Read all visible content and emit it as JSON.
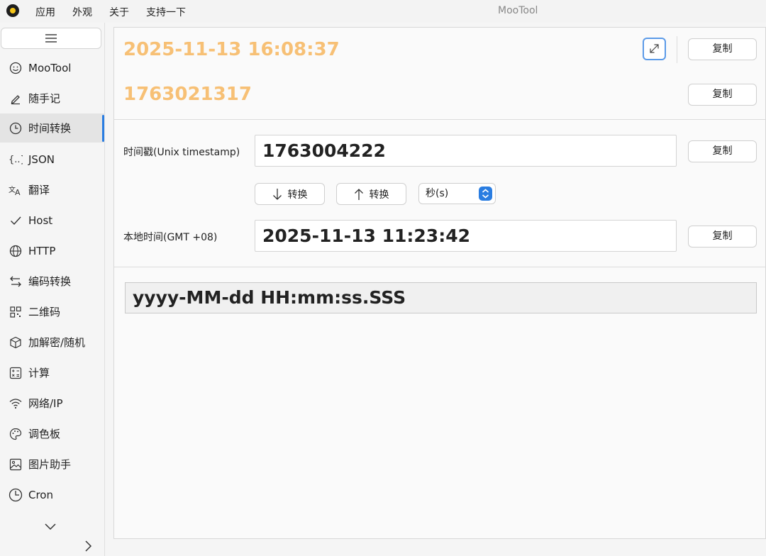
{
  "window": {
    "title": "MooTool"
  },
  "menu": {
    "items": [
      "应用",
      "外观",
      "关于",
      "支持一下"
    ]
  },
  "sidebar": {
    "items": [
      {
        "label": "MooTool",
        "icon": "smiley-icon",
        "active": false
      },
      {
        "label": "随手记",
        "icon": "pencil-icon",
        "active": false
      },
      {
        "label": "时间转换",
        "icon": "clock-icon",
        "active": true
      },
      {
        "label": "JSON",
        "icon": "braces-icon",
        "active": false
      },
      {
        "label": "翻译",
        "icon": "translate-icon",
        "active": false
      },
      {
        "label": "Host",
        "icon": "check-icon",
        "active": false
      },
      {
        "label": "HTTP",
        "icon": "globe-icon",
        "active": false
      },
      {
        "label": "编码转换",
        "icon": "swap-icon",
        "active": false
      },
      {
        "label": "二维码",
        "icon": "qrcode-icon",
        "active": false
      },
      {
        "label": "加解密/随机",
        "icon": "cube-icon",
        "active": false
      },
      {
        "label": "计算",
        "icon": "calculator-icon",
        "active": false
      },
      {
        "label": "网络/IP",
        "icon": "wifi-icon",
        "active": false
      },
      {
        "label": "调色板",
        "icon": "palette-icon",
        "active": false
      },
      {
        "label": "图片助手",
        "icon": "image-icon",
        "active": false
      },
      {
        "label": "Cron",
        "icon": "cron-clock-icon",
        "active": false
      }
    ]
  },
  "main": {
    "current_datetime": "2025-11-13 16:08:37",
    "current_timestamp": "1763021317",
    "copy_label": "复制",
    "timestamp_label": "时间戳(Unix timestamp)",
    "timestamp_value": "1763004222",
    "convert_down_label": "转换",
    "convert_up_label": "转换",
    "unit_value": "秒(s)",
    "local_time_label": "本地时间(GMT +08)",
    "local_time_value": "2025-11-13 11:23:42",
    "format_value": "yyyy-MM-dd HH:mm:ss.SSS"
  },
  "colors": {
    "accent": "#2a7de1",
    "highlight": "#f7c075"
  }
}
